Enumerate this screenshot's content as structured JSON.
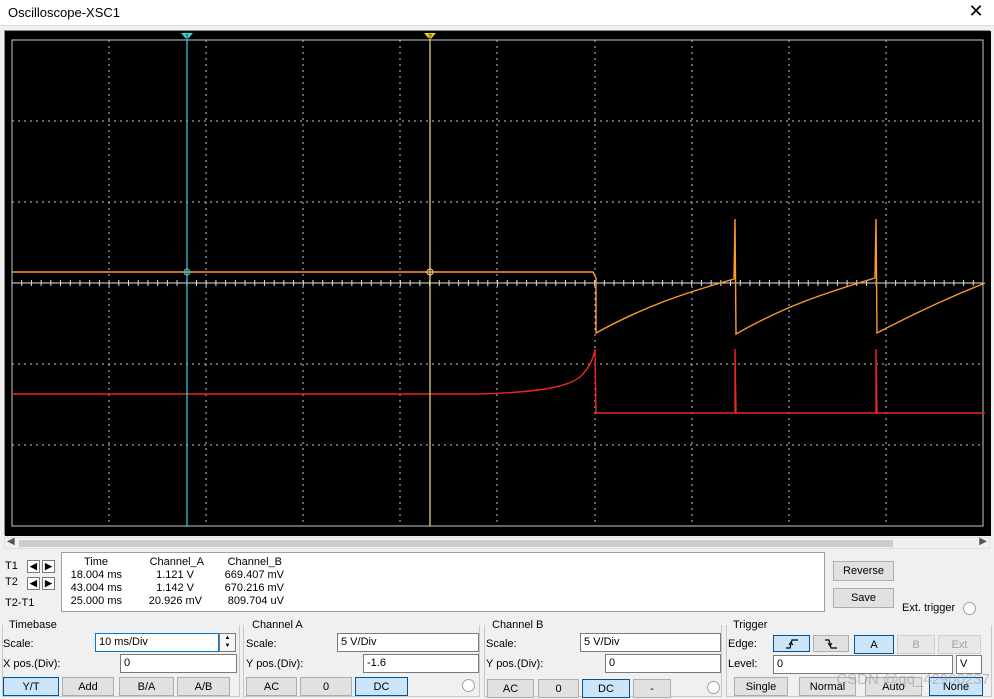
{
  "window": {
    "title": "Oscilloscope-XSC1",
    "close_glyph": "✕"
  },
  "colors": {
    "screen_bg": "#000000",
    "grid": "#c8c8c8",
    "channel_a": "#ff9a2e",
    "channel_b": "#e8281e",
    "cursor_1": "#3fd2dc",
    "cursor_2": "#f2e08c",
    "selected_button": "#cce4f7"
  },
  "cursors": {
    "t1_label": "T1",
    "t2_label": "T2",
    "t2t1_label": "T2-T1",
    "marker_1": "1",
    "marker_2": "2"
  },
  "readout": {
    "headers": [
      "Time",
      "Channel_A",
      "Channel_B"
    ],
    "rows": [
      [
        "18.004 ms",
        "1.121 V",
        "669.407 mV"
      ],
      [
        "43.004 ms",
        "1.142 V",
        "670.216 mV"
      ],
      [
        "25.000 ms",
        "20.926 mV",
        "809.704 uV"
      ]
    ]
  },
  "buttons": {
    "reverse": "Reverse",
    "save": "Save",
    "ext_trigger": "Ext. trigger"
  },
  "timebase": {
    "title": "Timebase",
    "scale_label": "Scale:",
    "scale_value": "10 ms/Div",
    "xpos_label": "X pos.(Div):",
    "xpos_value": "0",
    "modes": [
      "Y/T",
      "Add",
      "B/A",
      "A/B"
    ],
    "selected_mode": "Y/T"
  },
  "channel_a": {
    "title": "Channel A",
    "scale_label": "Scale:",
    "scale_value": "5  V/Div",
    "ypos_label": "Y pos.(Div):",
    "ypos_value": "-1.6",
    "coupling": [
      "AC",
      "0",
      "DC"
    ],
    "selected_coupling": "DC"
  },
  "channel_b": {
    "title": "Channel B",
    "scale_label": "Scale:",
    "scale_value": "5  V/Div",
    "ypos_label": "Y pos.(Div):",
    "ypos_value": "0",
    "coupling": [
      "AC",
      "0",
      "DC",
      "-"
    ],
    "selected_coupling": "DC"
  },
  "trigger": {
    "title": "Trigger",
    "edge_label": "Edge:",
    "rising_icon": "rising-edge-icon",
    "falling_icon": "falling-edge-icon",
    "sources": [
      "A",
      "B",
      "Ext"
    ],
    "selected_source": "A",
    "level_label": "Level:",
    "level_value": "0",
    "level_unit": "V",
    "modes": [
      "Single",
      "Normal",
      "Auto",
      "None"
    ],
    "selected_mode": "None"
  },
  "watermark": "CSDN @qq_42900237"
}
